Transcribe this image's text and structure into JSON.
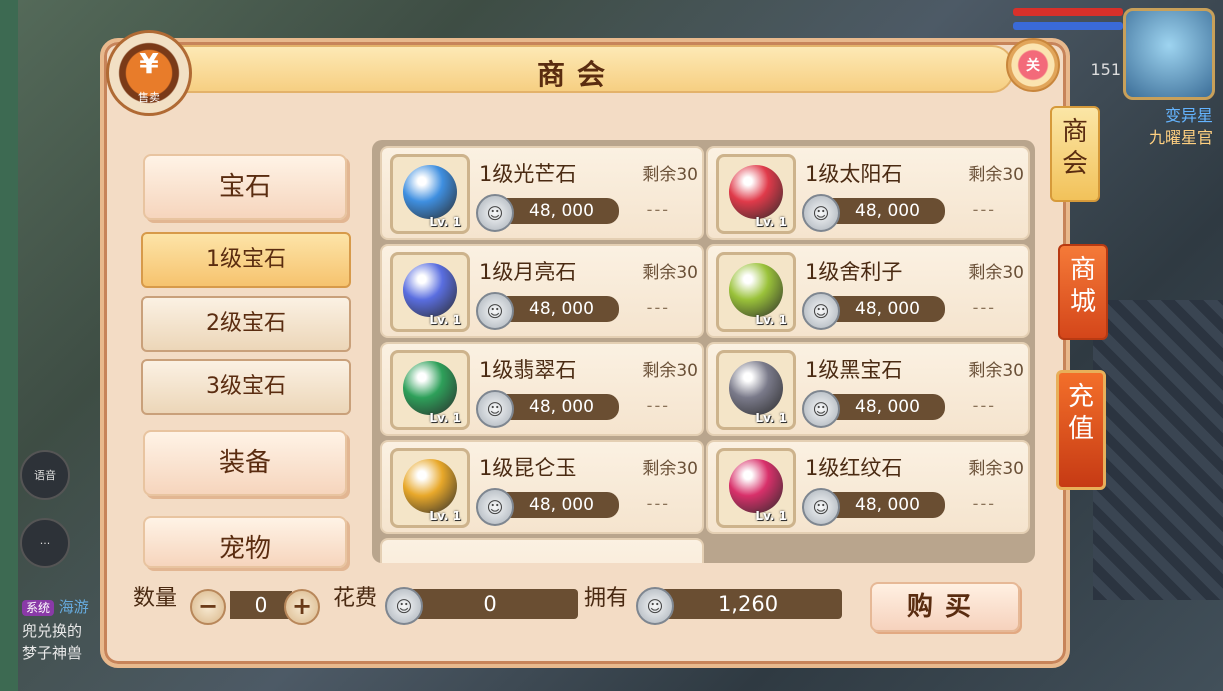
{
  "background": {
    "avatar_number": "151",
    "avatar_name_line1": "变异星",
    "avatar_name_line2": "九曜星官",
    "chat_bubble_label": "语音",
    "chat_lines": [
      "兜兑换的",
      "梦子神兽"
    ],
    "system_tag": "系统",
    "system_text": "海游"
  },
  "panel": {
    "title": "商会",
    "sell_badge_glyph": "¥",
    "sell_badge_label": "售卖",
    "close_label": "关"
  },
  "categories": [
    {
      "label": "宝石"
    },
    {
      "label": "装备"
    },
    {
      "label": "宠物"
    }
  ],
  "subcategories": [
    {
      "label": "1级宝石",
      "active": true
    },
    {
      "label": "2级宝石",
      "active": false
    },
    {
      "label": "3级宝石",
      "active": false
    }
  ],
  "items": [
    {
      "name": "1级光芒石",
      "remain": "剩余30",
      "price": "48, 000",
      "level": "Lv. 1",
      "extra": "---",
      "icon": "blue-crystal-gem-icon",
      "color": "#3f8fe0"
    },
    {
      "name": "1级太阳石",
      "remain": "剩余30",
      "price": "48, 000",
      "level": "Lv. 1",
      "extra": "---",
      "icon": "red-swirl-gem-icon",
      "color": "#e03a4a"
    },
    {
      "name": "1级月亮石",
      "remain": "剩余30",
      "price": "48, 000",
      "level": "Lv. 1",
      "extra": "---",
      "icon": "blue-crescent-gem-icon",
      "color": "#5a6ee0"
    },
    {
      "name": "1级舍利子",
      "remain": "剩余30",
      "price": "48, 000",
      "level": "Lv. 1",
      "extra": "---",
      "icon": "green-beads-icon",
      "color": "#9ac23a"
    },
    {
      "name": "1级翡翠石",
      "remain": "剩余30",
      "price": "48, 000",
      "level": "Lv. 1",
      "extra": "---",
      "icon": "green-orb-gem-icon",
      "color": "#2ea05a"
    },
    {
      "name": "1级黑宝石",
      "remain": "剩余30",
      "price": "48, 000",
      "level": "Lv. 1",
      "extra": "---",
      "icon": "dark-diamond-gem-icon",
      "color": "#7a7a8a"
    },
    {
      "name": "1级昆仑玉",
      "remain": "剩余30",
      "price": "48, 000",
      "level": "Lv. 1",
      "extra": "---",
      "icon": "amber-jade-gem-icon",
      "color": "#e8a82a"
    },
    {
      "name": "1级红纹石",
      "remain": "剩余30",
      "price": "48, 000",
      "level": "Lv. 1",
      "extra": "---",
      "icon": "pink-swirl-gem-icon",
      "color": "#d8306a"
    }
  ],
  "coin_glyph": "☺",
  "bottom": {
    "quantity_label": "数量",
    "quantity_value": "0",
    "minus": "−",
    "plus": "+",
    "cost_label": "花费",
    "cost_value": "0",
    "owned_label": "拥有",
    "owned_value": "1,260",
    "buy_label": "购买"
  },
  "side_tabs": [
    {
      "label": "商会"
    },
    {
      "label": "商城"
    },
    {
      "label": "充值"
    }
  ]
}
